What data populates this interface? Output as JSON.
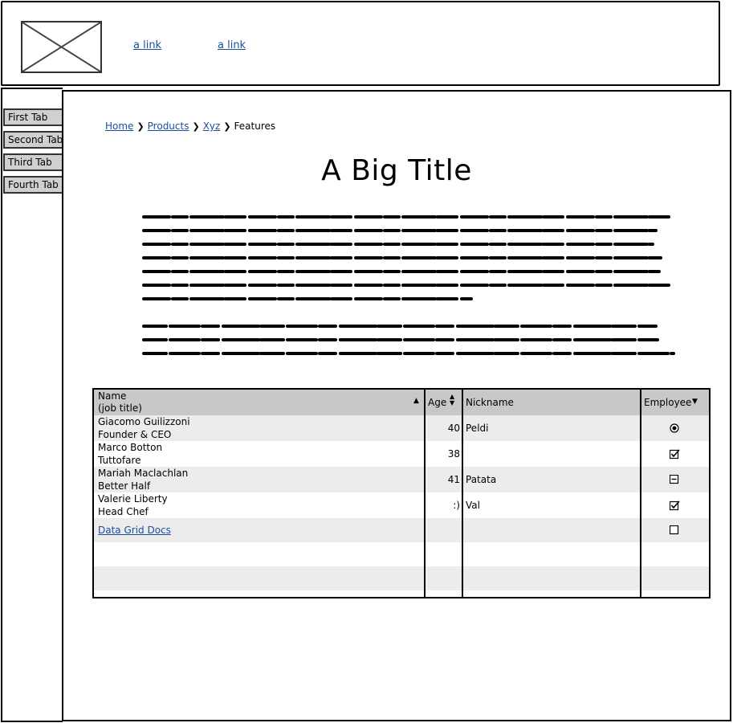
{
  "header": {
    "links": [
      "a link",
      "a link"
    ]
  },
  "sidebar": {
    "tabs": [
      "First Tab",
      "Second Tab",
      "Third Tab",
      "Fourth Tab"
    ]
  },
  "breadcrumb": {
    "items": [
      "Home",
      "Products",
      "Xyz",
      "Features"
    ]
  },
  "title": "A Big Title",
  "grid": {
    "headers": {
      "name_line1": "Name",
      "name_line2": "(job title)",
      "age": "Age",
      "nickname": "Nickname",
      "employee": "Employee"
    },
    "rows": [
      {
        "name": "Giacomo Guilizzoni",
        "job": "Founder & CEO",
        "age": "40",
        "nickname": "Peldi",
        "employee": "radio-selected"
      },
      {
        "name": "Marco Botton",
        "job": "Tuttofare",
        "age": "38",
        "nickname": "",
        "employee": "checked"
      },
      {
        "name": "Mariah Maclachlan",
        "job": "Better Half",
        "age": "41",
        "nickname": "Patata",
        "employee": "indeterminate"
      },
      {
        "name": "Valerie Liberty",
        "job": "Head Chef",
        "age": ":)",
        "nickname": "Val",
        "employee": "checked"
      }
    ],
    "link_row": {
      "label": "Data Grid Docs",
      "employee": "unchecked"
    }
  },
  "colors": {
    "header_bg": "#c8c8c8",
    "row_alt": "#ececec",
    "link": "#1a4f9c",
    "tab_bg": "#d0d0d0"
  }
}
